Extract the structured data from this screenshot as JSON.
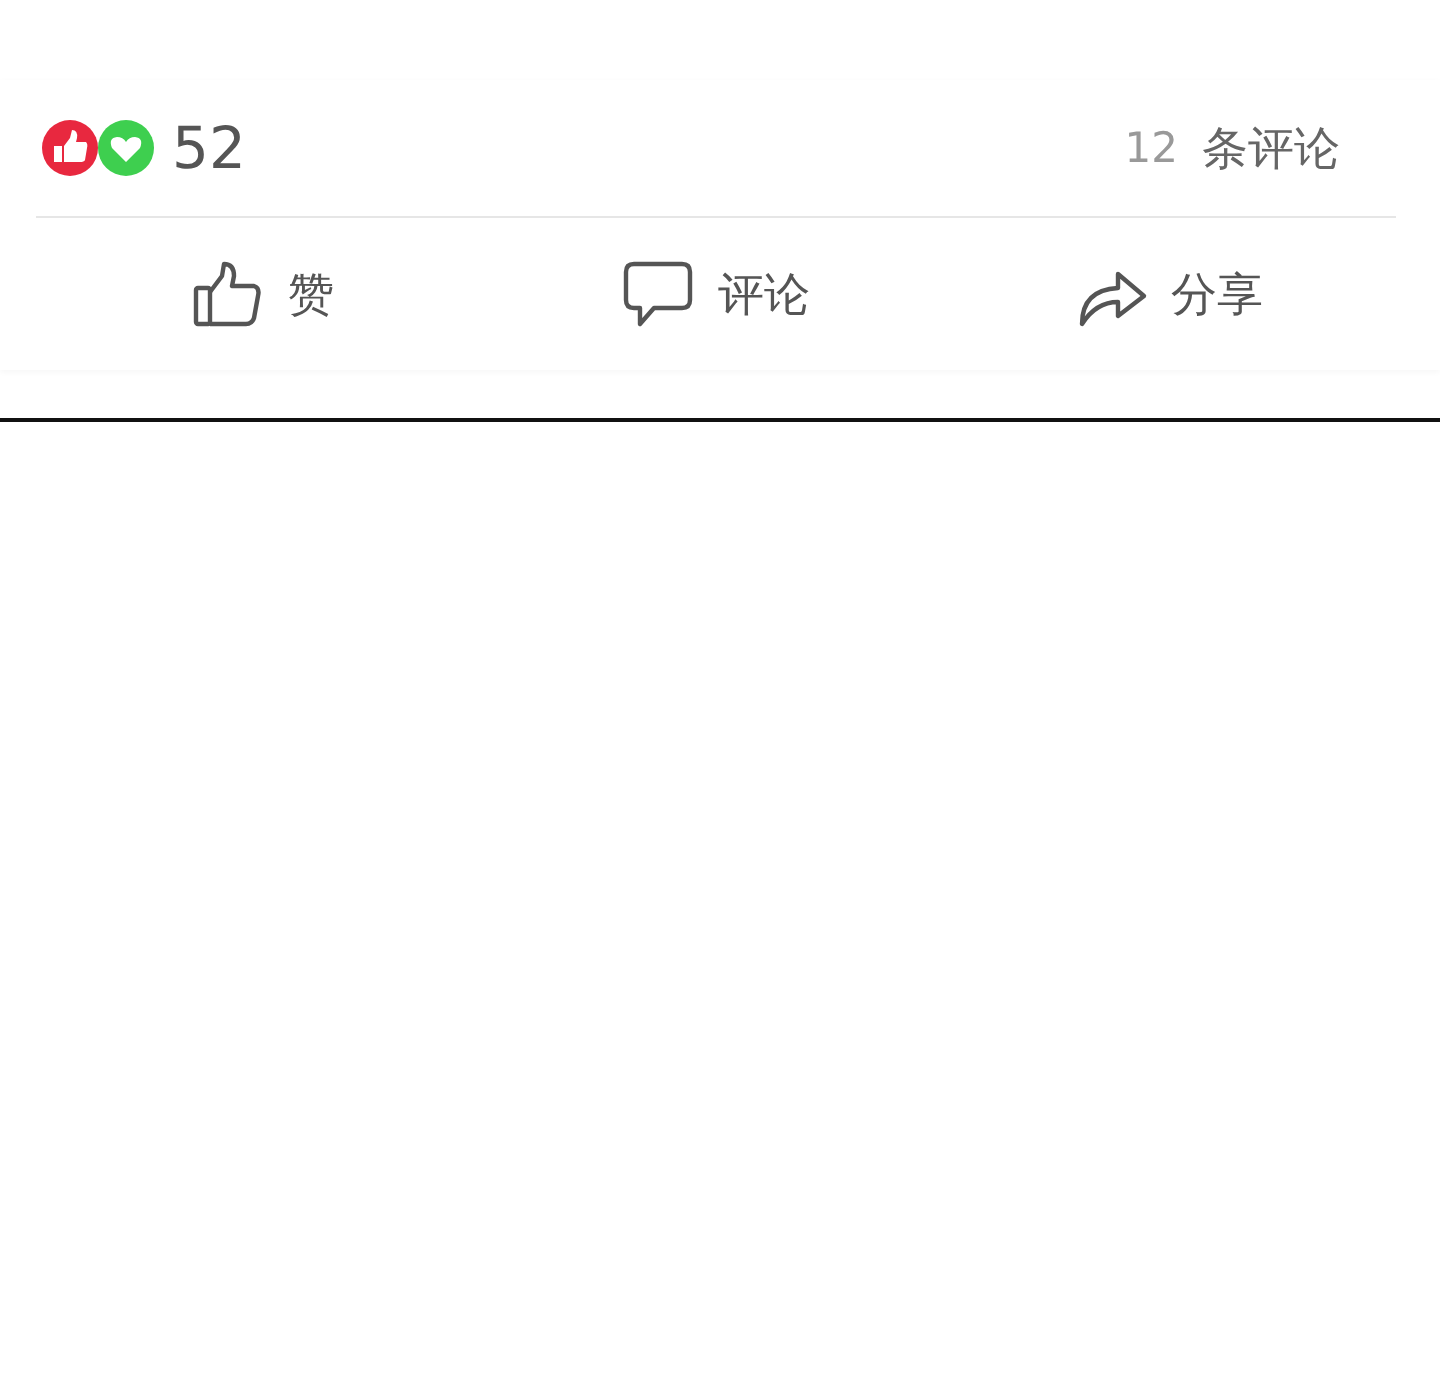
{
  "stats": {
    "reaction_count": "52",
    "comment_count": "12",
    "comment_label": "条评论"
  },
  "actions": [
    {
      "kind": "like",
      "label": "赞"
    },
    {
      "kind": "comment",
      "label": "评论"
    },
    {
      "kind": "share",
      "label": "分享"
    }
  ]
}
